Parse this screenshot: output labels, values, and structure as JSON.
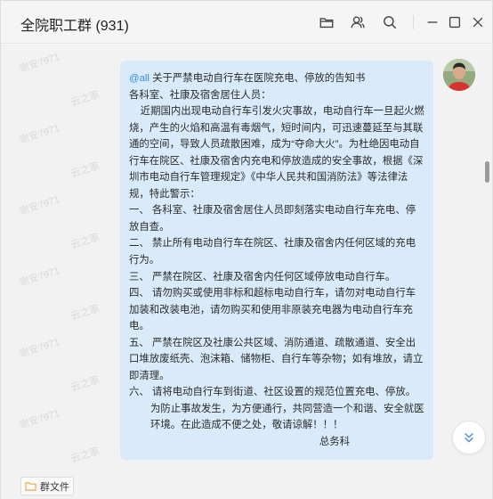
{
  "window": {
    "title": "全院职工群 (931)"
  },
  "watermark": {
    "text_a": "谢安7971",
    "text_b": "云之家"
  },
  "message": {
    "mention": "@all",
    "title_suffix": " 关于严禁电动自行车在医院充电、停放的告知书",
    "lines": [
      "各科室、社康及宿舍居住人员：",
      "    近期国内出现电动自行车引发火灾事故，电动自行车一旦起火燃烧，产生的火焰和高温有毒烟气，短时间内，可迅速蔓延至与其联通的空间，导致人员疏散困难，成为“夺命大火”。为杜绝因电动自行车在院区、社康及宿舍内充电和停放造成的安全事故，根据《深圳市电动自行车管理规定》《中华人民共和国消防法》等法律法规，特此警示：",
      "一、 各科室、社康及宿舍居住人员即刻落实电动自行车充电、停放自查。",
      "二、 禁止所有电动自行车在院区、社康及宿舍内任何区域的充电行为。",
      "三、 严禁在院区、社康及宿舍内任何区域停放电动自行车。",
      "四、 请勿购买或使用非标和超标电动自行车，请勿对电动自行车加装和改装电池，请勿购买和使用非原装充电器为电动自行车充电。",
      "五、 严禁在院区及社康公共区域、消防通道、疏散通道、安全出口堆放废纸壳、泡沫箱、储物柜、自行车等杂物；如有堆放，请立即清理。",
      "六、 请将电动自行车到街道、社区设置的规范位置充电、停放。"
    ],
    "closing": "为防止事故发生，为方便通行，共同营造一个和谐、安全就医环境。在此造成不便之处，敬请谅解！！！",
    "signature": "总务科"
  },
  "footer": {
    "file_button_label": "群文件"
  },
  "icons": {
    "folder": "folder-icon",
    "members": "members-icon",
    "search": "search-icon",
    "minimize": "minimize-icon",
    "maximize": "maximize-icon",
    "close": "close-icon",
    "jump_down": "double-chevron-down-icon"
  },
  "colors": {
    "bubble": "#d9ebfa",
    "mention": "#3a8ae5",
    "jump_arrow": "#4a90e2",
    "folder_accent": "#e8a33d"
  }
}
